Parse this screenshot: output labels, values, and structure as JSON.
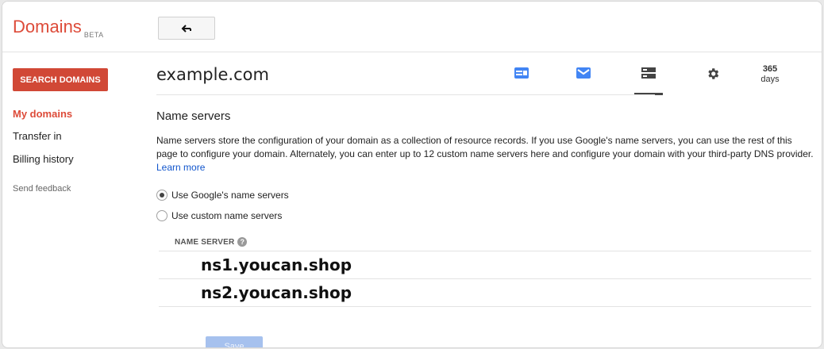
{
  "header": {
    "logo_text": "Domains",
    "logo_badge": "BETA",
    "back_icon": "back-arrow-icon"
  },
  "sidebar": {
    "search_button": "SEARCH DOMAINS",
    "items": [
      {
        "label": "My domains",
        "active": true
      },
      {
        "label": "Transfer in",
        "active": false
      },
      {
        "label": "Billing history",
        "active": false
      }
    ],
    "feedback": "Send feedback"
  },
  "main": {
    "domain": "example.com",
    "tabs": [
      {
        "icon": "website-icon",
        "color": "#4285f4"
      },
      {
        "icon": "email-icon",
        "color": "#4285f4"
      },
      {
        "icon": "dns-server-icon",
        "color": "#444444",
        "selected": true
      },
      {
        "icon": "settings-gear-icon",
        "color": "#444444"
      }
    ],
    "days": {
      "number": "365",
      "unit": "days"
    },
    "section_title": "Name servers",
    "description": "Name servers store the configuration of your domain as a collection of resource records. If you use Google's name servers, you can use the rest of this page to configure your domain. Alternately, you can enter up to 12 custom name servers here and configure your domain with your third-party DNS provider.",
    "learn_more": "Learn more",
    "options": [
      {
        "label": "Use Google's name servers",
        "checked": true
      },
      {
        "label": "Use custom name servers",
        "checked": false
      }
    ],
    "ns_header": "NAME SERVER",
    "name_servers": [
      "ns1.youcan.shop",
      "ns2.youcan.shop"
    ],
    "save_label": "Save"
  },
  "colors": {
    "brand_red": "#dd4b39",
    "button_red": "#d14836",
    "link_blue": "#1155cc",
    "save_disabled": "#a6c1ee"
  }
}
